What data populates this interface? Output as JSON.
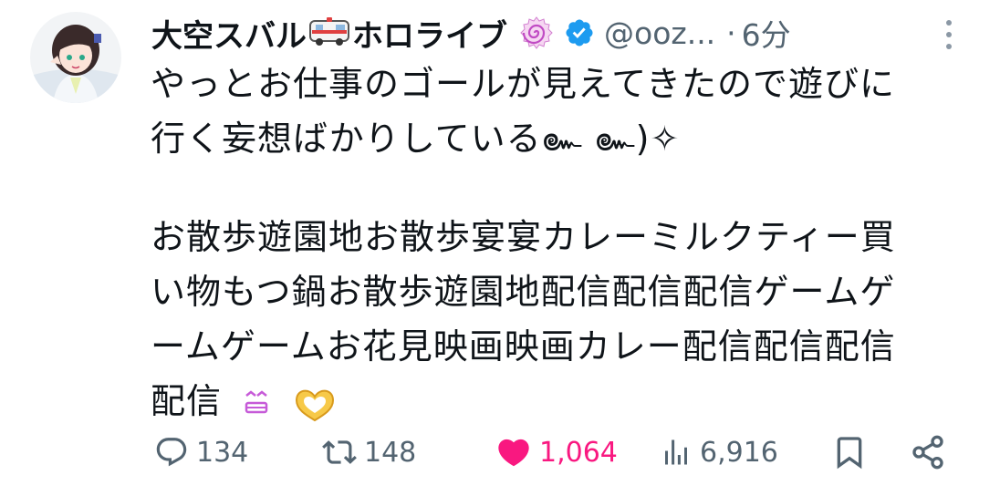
{
  "tweet": {
    "display_name_part1": "大空スバル",
    "display_name_part2": "ホロライブ",
    "handle": "@ooz...",
    "separator": "·",
    "time": "6分",
    "lines": [
      "やっとお仕事のゴールが見えてきたので遊びに",
      "行く妄想ばかりしている๛ ๛)✧",
      "お散歩遊園地お散歩宴宴カレーミルクティー買",
      "い物もつ鍋お散歩遊園地配信配信配信ゲームゲ",
      "ームゲームお花見映画映画カレー配信配信配信",
      "配信"
    ]
  },
  "actions": {
    "replies": "134",
    "retweets": "148",
    "likes": "1,064",
    "views": "6,916"
  },
  "colors": {
    "like": "#f91880",
    "verified": "#1d9bf0",
    "muted": "#536471",
    "text": "#0f1419"
  },
  "icons": [
    "avatar",
    "ambulance-emoji",
    "naruto-emoji",
    "verified-badge-icon",
    "more-icon",
    "grin-emoji",
    "heart-hands-emoji",
    "reply-icon",
    "retweet-icon",
    "like-icon",
    "views-icon",
    "bookmark-icon",
    "share-icon"
  ]
}
